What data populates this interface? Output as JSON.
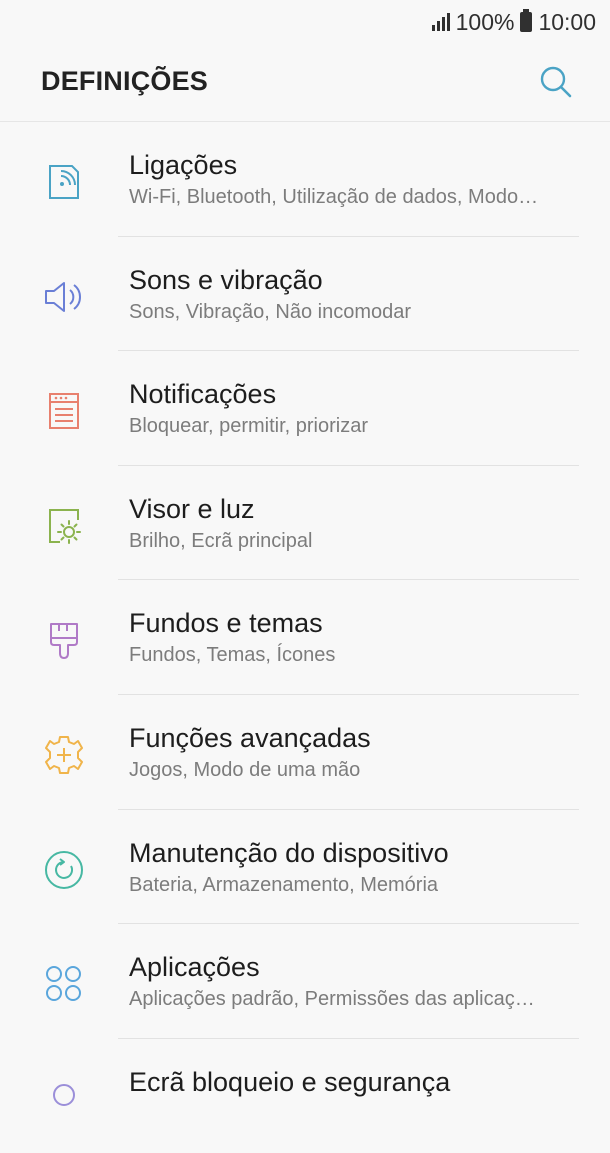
{
  "status_bar": {
    "battery_percent": "100%",
    "time": "10:00"
  },
  "header": {
    "title": "DEFINIÇÕES",
    "search_icon": "search-icon"
  },
  "colors": {
    "accent": "#4aa3c5",
    "ligacoes": "#4aa3c5",
    "sons": "#6a7fd6",
    "notificacoes": "#e8806e",
    "visor": "#8bb34e",
    "fundos": "#b07ac7",
    "funcoes": "#f0b44a",
    "manutencao": "#47b8a3",
    "aplicacoes": "#5aa6dc",
    "ecra": "#9b8fd9"
  },
  "items": [
    {
      "title": "Ligações",
      "subtitle": "Wi-Fi, Bluetooth, Utilização de dados, Modo…",
      "icon": "connections-icon"
    },
    {
      "title": "Sons e vibração",
      "subtitle": "Sons, Vibração, Não incomodar",
      "icon": "speaker-icon"
    },
    {
      "title": "Notificações",
      "subtitle": "Bloquear, permitir, priorizar",
      "icon": "notifications-icon"
    },
    {
      "title": "Visor e luz",
      "subtitle": "Brilho, Ecrã principal",
      "icon": "display-icon"
    },
    {
      "title": "Fundos e temas",
      "subtitle": "Fundos, Temas, Ícones",
      "icon": "paintbrush-icon"
    },
    {
      "title": "Funções avançadas",
      "subtitle": "Jogos, Modo de uma mão",
      "icon": "advanced-gear-icon"
    },
    {
      "title": "Manutenção do dispositivo",
      "subtitle": "Bateria, Armazenamento, Memória",
      "icon": "maintenance-icon"
    },
    {
      "title": "Aplicações",
      "subtitle": "Aplicações padrão, Permissões das aplicaç…",
      "icon": "apps-icon"
    },
    {
      "title": "Ecrã bloqueio e segurança",
      "subtitle": "",
      "icon": "lock-icon"
    }
  ]
}
